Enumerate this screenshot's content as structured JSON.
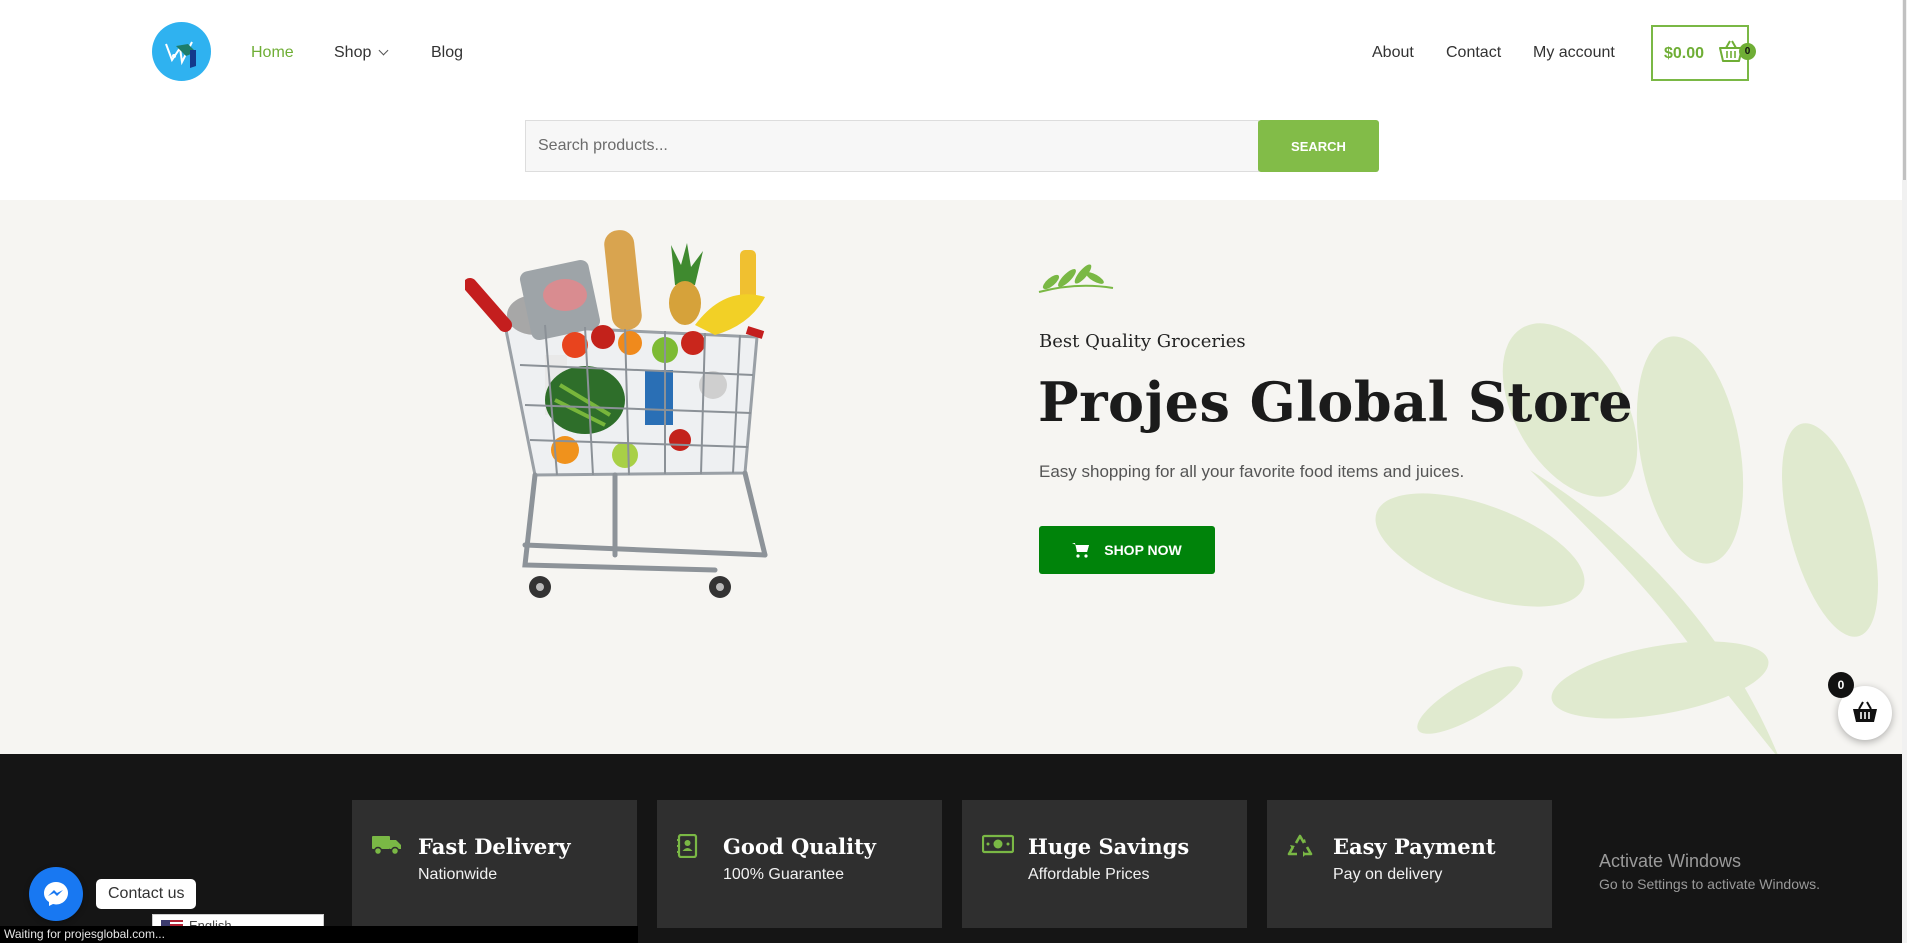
{
  "header": {
    "nav_left": [
      {
        "label": "Home",
        "active": true
      },
      {
        "label": "Shop",
        "has_dropdown": true
      },
      {
        "label": "Blog"
      }
    ],
    "nav_right": [
      {
        "label": "About"
      },
      {
        "label": "Contact"
      },
      {
        "label": "My account"
      }
    ],
    "cart": {
      "total": "$0.00",
      "count": "0"
    }
  },
  "search": {
    "placeholder": "Search products...",
    "button_label": "SEARCH"
  },
  "hero": {
    "subtitle": "Best Quality Groceries",
    "title": "Projes Global Store",
    "text": "Easy shopping for all your favorite food items and juices.",
    "button_label": "SHOP NOW"
  },
  "features": [
    {
      "icon": "truck-icon",
      "title": "Fast Delivery",
      "subtitle": "Nationwide"
    },
    {
      "icon": "contact-book-icon",
      "title": "Good Quality",
      "subtitle": "100% Guarantee"
    },
    {
      "icon": "money-icon",
      "title": "Huge Savings",
      "subtitle": "Affordable Prices"
    },
    {
      "icon": "recycle-icon",
      "title": "Easy Payment",
      "subtitle": "Pay on delivery"
    }
  ],
  "floating_cart": {
    "count": "0"
  },
  "messenger": {
    "label": "Contact us"
  },
  "language": {
    "label": "English"
  },
  "windows_watermark": {
    "title": "Activate Windows",
    "subtitle": "Go to Settings to activate Windows."
  },
  "status_bar": {
    "text": "Waiting for projesglobal.com..."
  },
  "colors": {
    "accent": "#82bc48",
    "brand_green": "#00830a",
    "dark": "#151515",
    "card": "#2f2f2f"
  }
}
